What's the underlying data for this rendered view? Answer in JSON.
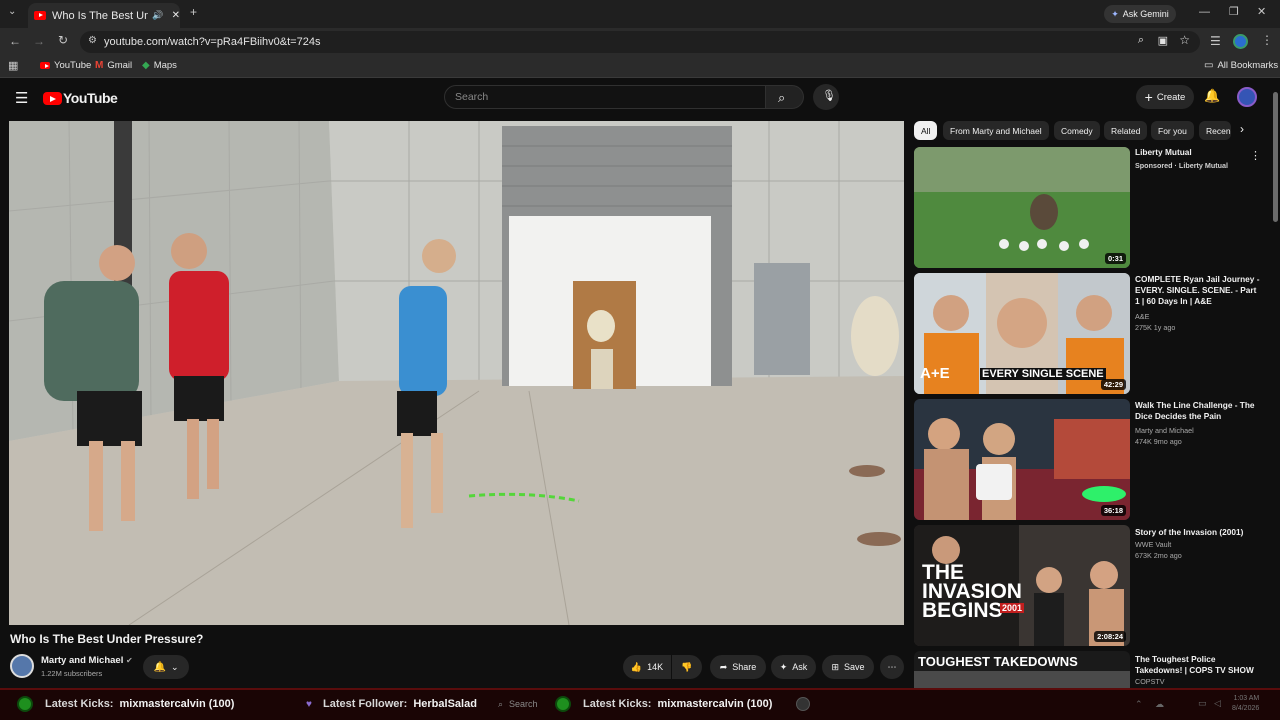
{
  "browser": {
    "tab_title": "Who Is The Best Under Pre",
    "new_tab_symbol": "+",
    "url": "youtube.com/watch?v=pRa4FBiihv0&t=724s",
    "ask_gemini": "Ask Gemini",
    "bookmarks": [
      "YouTube",
      "Gmail",
      "Maps"
    ],
    "all_bookmarks": "All Bookmarks"
  },
  "header": {
    "logo_text": "YouTube",
    "search_placeholder": "Search",
    "create_label": "Create"
  },
  "video": {
    "title": "Who Is The Best Under Pressure?",
    "channel": "Marty and Michael",
    "subscribers": "1.22M subscribers",
    "likes": "14K",
    "share_label": "Share",
    "ask_label": "Ask",
    "save_label": "Save"
  },
  "chips": [
    "All",
    "From Marty and Michael",
    "Comedy",
    "Related",
    "For you",
    "Recen"
  ],
  "recommendations": [
    {
      "title": "Liberty Mutual",
      "meta1": "Sponsored · Liberty Mutual",
      "meta2": "",
      "duration": "0:31"
    },
    {
      "title": "COMPLETE Ryan Jail Journey - EVERY. SINGLE. SCENE. - Part 1 | 60 Days In | A&E",
      "meta1": "A&E",
      "meta2": "275K  1y ago",
      "duration": "42:29",
      "thumb_text": "EVERY SINGLE SCENE"
    },
    {
      "title": "Walk The Line Challenge - The Dice Decides the Pain",
      "meta1": "Marty and Michael",
      "meta2": "474K  9mo ago",
      "duration": "36:18"
    },
    {
      "title": "Story of the Invasion (2001)",
      "meta1": "WWE Vault",
      "meta2": "673K  2mo ago",
      "duration": "2:08:24",
      "thumb_text": "THE INVASION BEGINS",
      "thumb_badge": "2001"
    },
    {
      "title": "The Toughest Police Takedowns! | COPS TV SHOW",
      "meta1": "COPSTV",
      "meta2": "",
      "thumb_text": "TOUGHEST TAKEDOWNS"
    }
  ],
  "overlay": {
    "label1": "Latest Kicks:",
    "value1": "mixmastercalvin (100)",
    "label2": "Latest Follower:",
    "value2": "HerbalSalad",
    "search": "Search",
    "label3": "Latest Kicks:",
    "value3": "mixmastercalvin (100)",
    "time": "1:03 AM",
    "date": "8/4/2026"
  },
  "colors": {
    "youtube_red": "#ff0000",
    "page_bg": "#0f0f0f",
    "overlay_bg": "#1a0505",
    "kick_green": "#1e8f1e"
  }
}
